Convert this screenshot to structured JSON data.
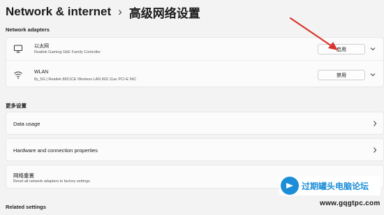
{
  "breadcrumb": {
    "parent": "Network & internet",
    "separator": "›",
    "current": "高级网络设置"
  },
  "sections": {
    "network_adapters": "Network adapters",
    "more_settings": "更多设置",
    "related_settings": "Related settings"
  },
  "adapters": [
    {
      "name": "以太网",
      "description": "Realtek Gaming GbE Family Controller",
      "button": "启用",
      "icon": "monitor-network-icon"
    },
    {
      "name": "WLAN",
      "description": "fly_5G | Realtek 8821CE Wireless LAN 802.11ac PCI-E NIC",
      "button": "禁用",
      "icon": "wifi-icon"
    }
  ],
  "more_settings": [
    {
      "title": "Data usage",
      "subtitle": ""
    },
    {
      "title": "Hardware and connection properties",
      "subtitle": ""
    },
    {
      "title": "网络重置",
      "subtitle": "Reset all network adapters to factory settings"
    }
  ],
  "watermark": {
    "text": "过期罐头电脑论坛",
    "url": "www.gqgtpc.com"
  },
  "colors": {
    "arrow": "#d9342b",
    "background": "#f3f3f3",
    "card": "#fbfbfb",
    "brand": "#1c8ed8"
  }
}
